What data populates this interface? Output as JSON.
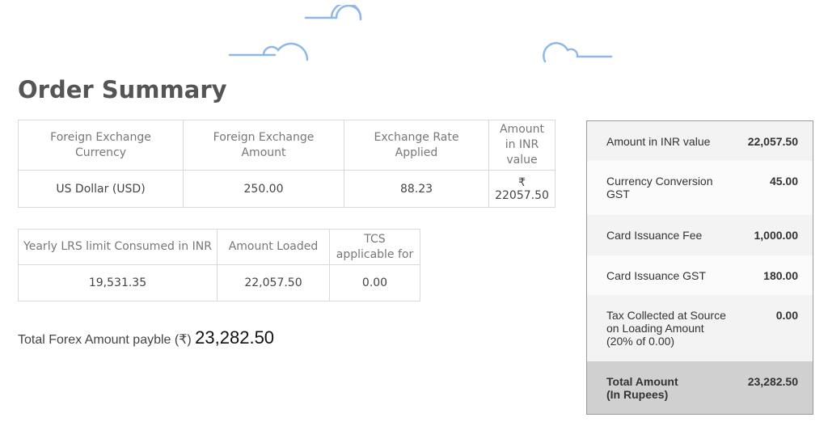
{
  "page": {
    "title": "Order Summary"
  },
  "rates_table": {
    "headers": [
      "Foreign Exchange Currency",
      "Foreign Exchange Amount",
      "Exchange Rate Applied",
      "Amount in INR value"
    ],
    "row": {
      "currency": "US Dollar (USD)",
      "amount": "250.00",
      "rate": "88.23",
      "inr_value": "₹ 22057.50"
    }
  },
  "lrs_table": {
    "headers": [
      "Yearly LRS limit Consumed in INR",
      "Amount Loaded",
      "TCS applicable for"
    ],
    "row": {
      "lrs_consumed": "19,531.35",
      "amount_loaded": "22,057.50",
      "tcs": "0.00"
    }
  },
  "total_forex": {
    "label": "Total Forex Amount payble (₹)",
    "amount": "23,282.50"
  },
  "summary": {
    "rows": [
      {
        "label": "Amount in INR value",
        "value": "22,057.50"
      },
      {
        "label": "Currency Conversion GST",
        "value": "45.00"
      },
      {
        "label": "Card Issuance Fee",
        "value": "1,000.00"
      },
      {
        "label": "Card Issuance GST",
        "value": "180.00"
      },
      {
        "label": "Tax Collected at Source on Loading Amount (20% of 0.00)",
        "value": "0.00"
      }
    ],
    "total": {
      "label_line1": "Total Amount",
      "label_line2": "(In Rupees)",
      "value": "23,282.50"
    }
  },
  "colors": {
    "cloud": "#8fb8e8",
    "title": "#555555",
    "total_row_bg": "#d0d0d0"
  },
  "icons": [
    "cloud-icon",
    "cloud-icon",
    "cloud-icon"
  ]
}
